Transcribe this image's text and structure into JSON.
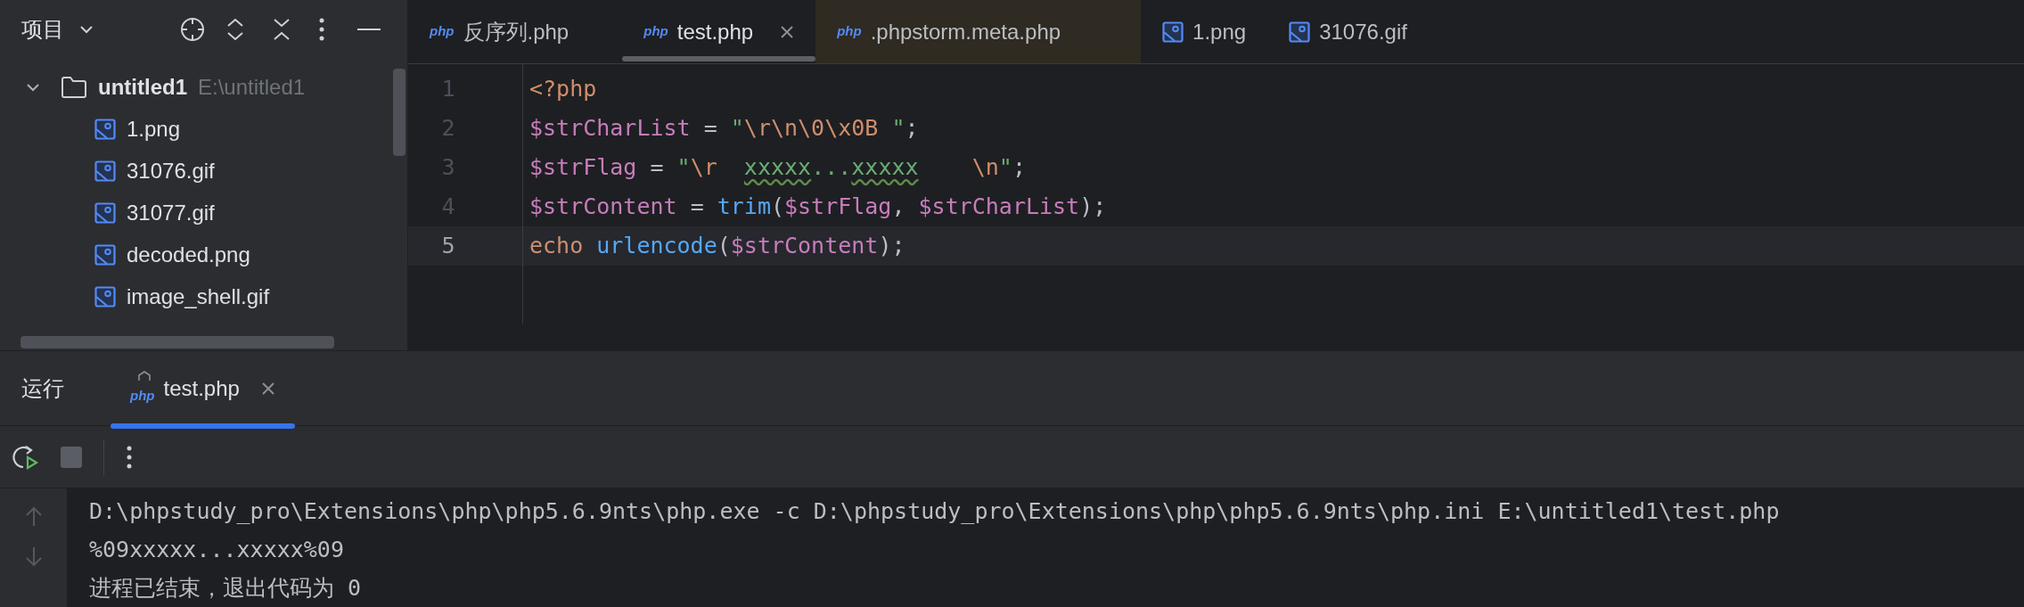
{
  "sidebar": {
    "title": "项目",
    "tree": [
      {
        "name": "untitled1",
        "path": "E:\\untitled1",
        "kind": "folder",
        "expanded": true,
        "children": [
          {
            "name": "1.png",
            "kind": "image"
          },
          {
            "name": "31076.gif",
            "kind": "image"
          },
          {
            "name": "31077.gif",
            "kind": "image"
          },
          {
            "name": "decoded.png",
            "kind": "image"
          },
          {
            "name": "image_shell.gif",
            "kind": "image"
          }
        ]
      }
    ]
  },
  "editor_tabs": [
    {
      "label": "反序列.php",
      "kind": "php",
      "badge": "php",
      "selected": false,
      "closable": false,
      "tinted": false
    },
    {
      "label": "test.php",
      "kind": "php",
      "badge": "php",
      "selected": true,
      "closable": true,
      "tinted": false
    },
    {
      "label": ".phpstorm.meta.php",
      "kind": "php",
      "badge": "php",
      "selected": false,
      "closable": false,
      "tinted": true
    },
    {
      "label": "1.png",
      "kind": "image",
      "selected": false,
      "closable": false,
      "tinted": false
    },
    {
      "label": "31076.gif",
      "kind": "image",
      "selected": false,
      "closable": false,
      "tinted": false
    }
  ],
  "code": [
    {
      "number": "1",
      "current": false,
      "tokens": [
        {
          "kind": "keyword",
          "text": "<?php"
        }
      ]
    },
    {
      "number": "2",
      "current": false,
      "tokens": [
        {
          "kind": "var",
          "text": "$strCharList"
        },
        {
          "kind": "plain",
          "text": " = "
        },
        {
          "kind": "string",
          "text": "\""
        },
        {
          "kind": "escape",
          "text": "\\r\\n\\0\\x0B"
        },
        {
          "kind": "string",
          "text": " \""
        },
        {
          "kind": "plain",
          "text": ";"
        }
      ]
    },
    {
      "number": "3",
      "current": false,
      "tokens": [
        {
          "kind": "var",
          "text": "$strFlag"
        },
        {
          "kind": "plain",
          "text": " = "
        },
        {
          "kind": "string",
          "text": "\""
        },
        {
          "kind": "escape",
          "text": "\\r  "
        },
        {
          "kind": "typo",
          "text": "xxxxx"
        },
        {
          "kind": "string",
          "text": "..."
        },
        {
          "kind": "typo",
          "text": "xxxxx"
        },
        {
          "kind": "escape",
          "text": "    \\n"
        },
        {
          "kind": "string",
          "text": "\""
        },
        {
          "kind": "plain",
          "text": ";"
        }
      ]
    },
    {
      "number": "4",
      "current": false,
      "tokens": [
        {
          "kind": "var",
          "text": "$strContent"
        },
        {
          "kind": "plain",
          "text": " = "
        },
        {
          "kind": "func",
          "text": "trim"
        },
        {
          "kind": "plain",
          "text": "("
        },
        {
          "kind": "var",
          "text": "$strFlag"
        },
        {
          "kind": "plain",
          "text": ", "
        },
        {
          "kind": "var",
          "text": "$strCharList"
        },
        {
          "kind": "plain",
          "text": ");"
        }
      ]
    },
    {
      "number": "5",
      "current": true,
      "tokens": [
        {
          "kind": "keyword",
          "text": "echo "
        },
        {
          "kind": "func",
          "text": "urlencode"
        },
        {
          "kind": "plain",
          "text": "("
        },
        {
          "kind": "var",
          "text": "$strContent"
        },
        {
          "kind": "plain",
          "text": ");"
        }
      ]
    }
  ],
  "run_panel": {
    "title": "运行",
    "tabs": [
      {
        "label": "test.php",
        "badge": "php",
        "selected": true
      }
    ],
    "console": [
      {
        "text": "D:\\phpstudy_pro\\Extensions\\php\\php5.6.9nts\\php.exe -c D:\\phpstudy_pro\\Extensions\\php\\php5.6.9nts\\php.ini E:\\untitled1\\test.php"
      },
      {
        "text": "%09xxxxx...xxxxx%09"
      },
      {
        "text": "进程已结束，退出代码为 0"
      }
    ]
  }
}
